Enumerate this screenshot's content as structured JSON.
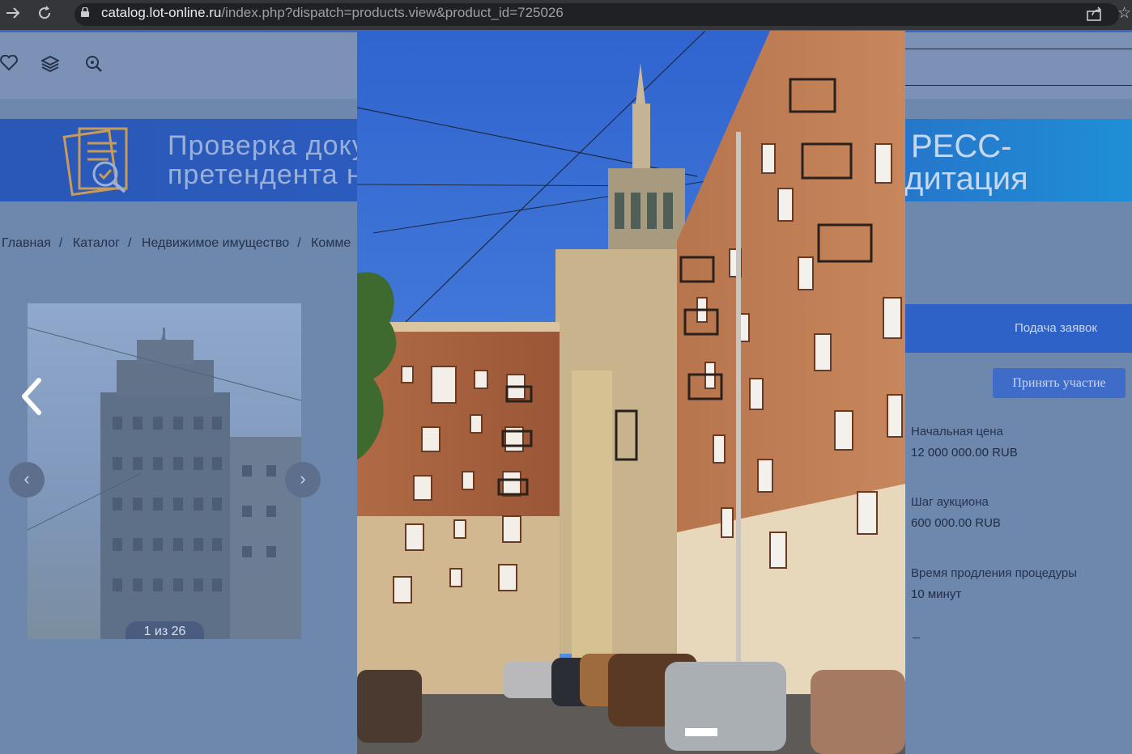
{
  "browser": {
    "back_icon": "arrow-right-icon",
    "reload_icon": "reload-icon",
    "url_host": "catalog.lot-online.ru",
    "url_path": "/index.php?dispatch=products.view&product_id=725026",
    "share_icon": "share-icon",
    "star_icon": "star-icon"
  },
  "header": {
    "icons": [
      "heart-icon",
      "layers-icon",
      "search-icon"
    ]
  },
  "banner": {
    "left_line1": "Проверка доку",
    "left_line2": "претендента н",
    "right_line1": "РЕСС-",
    "right_line2": "дитация"
  },
  "breadcrumb": {
    "items": [
      "Главная",
      "Каталог",
      "Недвижимое имущество",
      "Комме"
    ],
    "separator": "/"
  },
  "gallery": {
    "counter": "1 из 26"
  },
  "side": {
    "apply_label": "Подача заявок",
    "participate_label": "Принять участие",
    "start_price_label": "Начальная цена",
    "start_price_value": "12 000 000.00 RUB",
    "step_label": "Шаг аукциона",
    "step_value": "600 000.00 RUB",
    "extension_label": "Время продления процедуры",
    "extension_value": "10 минут"
  },
  "colors": {
    "accent": "#2f62c6",
    "overlay": "#6e87ad",
    "sky": "#3b74d6",
    "brick": "#b8693e"
  }
}
